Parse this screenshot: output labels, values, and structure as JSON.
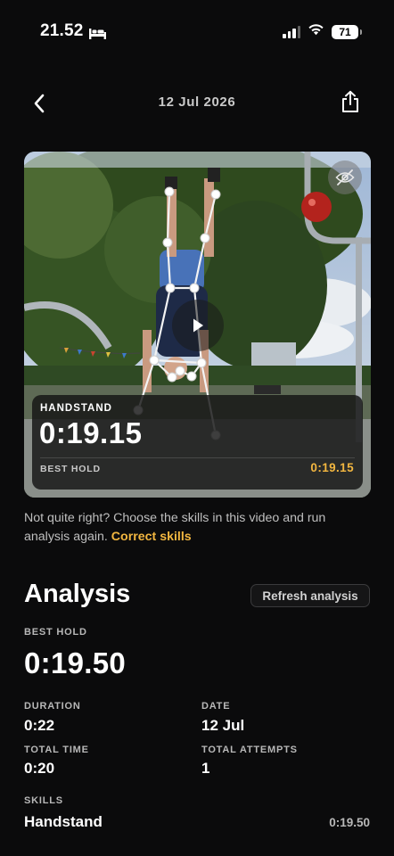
{
  "status_bar": {
    "time": "21.52",
    "battery": "71",
    "icons": [
      "bed-icon",
      "signal-icon",
      "wifi-icon",
      "battery-icon"
    ]
  },
  "nav": {
    "title": "12 Jul 2026",
    "icons": [
      "chevron-left-icon",
      "share-icon"
    ]
  },
  "video": {
    "icons": [
      "eye-slash-icon",
      "play-icon"
    ],
    "overlay": {
      "skill": "HANDSTAND",
      "time": "0:19.15",
      "best_label": "BEST HOLD",
      "best_value": "0:19.15"
    }
  },
  "info": {
    "text": "Not quite right? Choose the skills in this video and run analysis again. ",
    "link": "Correct skills"
  },
  "analysis": {
    "title": "Analysis",
    "refresh_label": "Refresh analysis",
    "best_hold_label": "BEST HOLD",
    "best_hold_value": "0:19.50",
    "duration_label": "DURATION",
    "duration_value": "0:22",
    "date_label": "DATE",
    "date_value": "12 Jul",
    "total_time_label": "TOTAL TIME",
    "total_time_value": "0:20",
    "total_attempts_label": "TOTAL ATTEMPTS",
    "total_attempts_value": "1",
    "skills_label": "SKILLS",
    "skills": [
      {
        "name": "Handstand",
        "time": "0:19.50"
      }
    ]
  },
  "colors": {
    "background": "#0b0b0c",
    "accent": "#f2b640",
    "muted": "#b8b8b8"
  }
}
